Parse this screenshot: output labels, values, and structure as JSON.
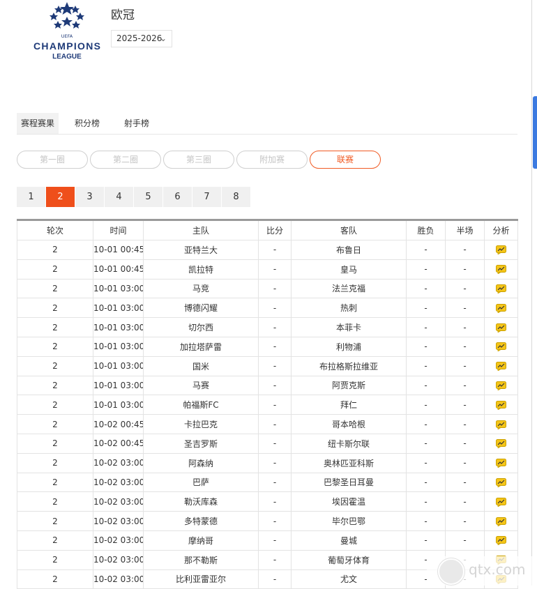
{
  "logo": {
    "text_top": "UEFA",
    "text_main": "CHAMPIONS",
    "text_bottom": "LEAGUE"
  },
  "header": {
    "title": "欧冠",
    "season": "2025-2026"
  },
  "tabs": [
    "赛程赛果",
    "积分榜",
    "射手榜"
  ],
  "rounds": [
    {
      "label": "第一圈",
      "active": false
    },
    {
      "label": "第二圈",
      "active": false
    },
    {
      "label": "第三圈",
      "active": false
    },
    {
      "label": "附加赛",
      "active": false
    },
    {
      "label": "联赛",
      "active": true
    }
  ],
  "pages": [
    "1",
    "2",
    "3",
    "4",
    "5",
    "6",
    "7",
    "8"
  ],
  "current_page": "2",
  "table": {
    "headers": [
      "轮次",
      "时间",
      "主队",
      "比分",
      "客队",
      "胜负",
      "半场",
      "分析"
    ],
    "rows": [
      [
        "2",
        "10-01 00:45",
        "亚特兰大",
        "-",
        "布鲁日",
        "-",
        "-"
      ],
      [
        "2",
        "10-01 00:45",
        "凯拉特",
        "-",
        "皇马",
        "-",
        "-"
      ],
      [
        "2",
        "10-01 03:00",
        "马竞",
        "-",
        "法兰克福",
        "-",
        "-"
      ],
      [
        "2",
        "10-01 03:00",
        "博德闪耀",
        "-",
        "热刺",
        "-",
        "-"
      ],
      [
        "2",
        "10-01 03:00",
        "切尔西",
        "-",
        "本菲卡",
        "-",
        "-"
      ],
      [
        "2",
        "10-01 03:00",
        "加拉塔萨雷",
        "-",
        "利物浦",
        "-",
        "-"
      ],
      [
        "2",
        "10-01 03:00",
        "国米",
        "-",
        "布拉格斯拉维亚",
        "-",
        "-"
      ],
      [
        "2",
        "10-01 03:00",
        "马赛",
        "-",
        "阿贾克斯",
        "-",
        "-"
      ],
      [
        "2",
        "10-01 03:00",
        "帕福斯FC",
        "-",
        "拜仁",
        "-",
        "-"
      ],
      [
        "2",
        "10-02 00:45",
        "卡拉巴克",
        "-",
        "哥本哈根",
        "-",
        "-"
      ],
      [
        "2",
        "10-02 00:45",
        "圣吉罗斯",
        "-",
        "纽卡斯尔联",
        "-",
        "-"
      ],
      [
        "2",
        "10-02 03:00",
        "阿森纳",
        "-",
        "奥林匹亚科斯",
        "-",
        "-"
      ],
      [
        "2",
        "10-02 03:00",
        "巴萨",
        "-",
        "巴黎圣日耳曼",
        "-",
        "-"
      ],
      [
        "2",
        "10-02 03:00",
        "勒沃库森",
        "-",
        "埃因霍温",
        "-",
        "-"
      ],
      [
        "2",
        "10-02 03:00",
        "多特蒙德",
        "-",
        "毕尔巴鄂",
        "-",
        "-"
      ],
      [
        "2",
        "10-02 03:00",
        "摩纳哥",
        "-",
        "曼城",
        "-",
        "-"
      ],
      [
        "2",
        "10-02 03:00",
        "那不勒斯",
        "-",
        "葡萄牙体育",
        "-",
        "-"
      ],
      [
        "2",
        "10-02 03:00",
        "比利亚雷亚尔",
        "-",
        "尤文",
        "-",
        "-"
      ]
    ]
  },
  "watermark": "qtx.com",
  "colors": {
    "accent": "#ef4f1b",
    "analysis_icon": "#f5c518",
    "edge_tab": "#3c7ae0"
  }
}
